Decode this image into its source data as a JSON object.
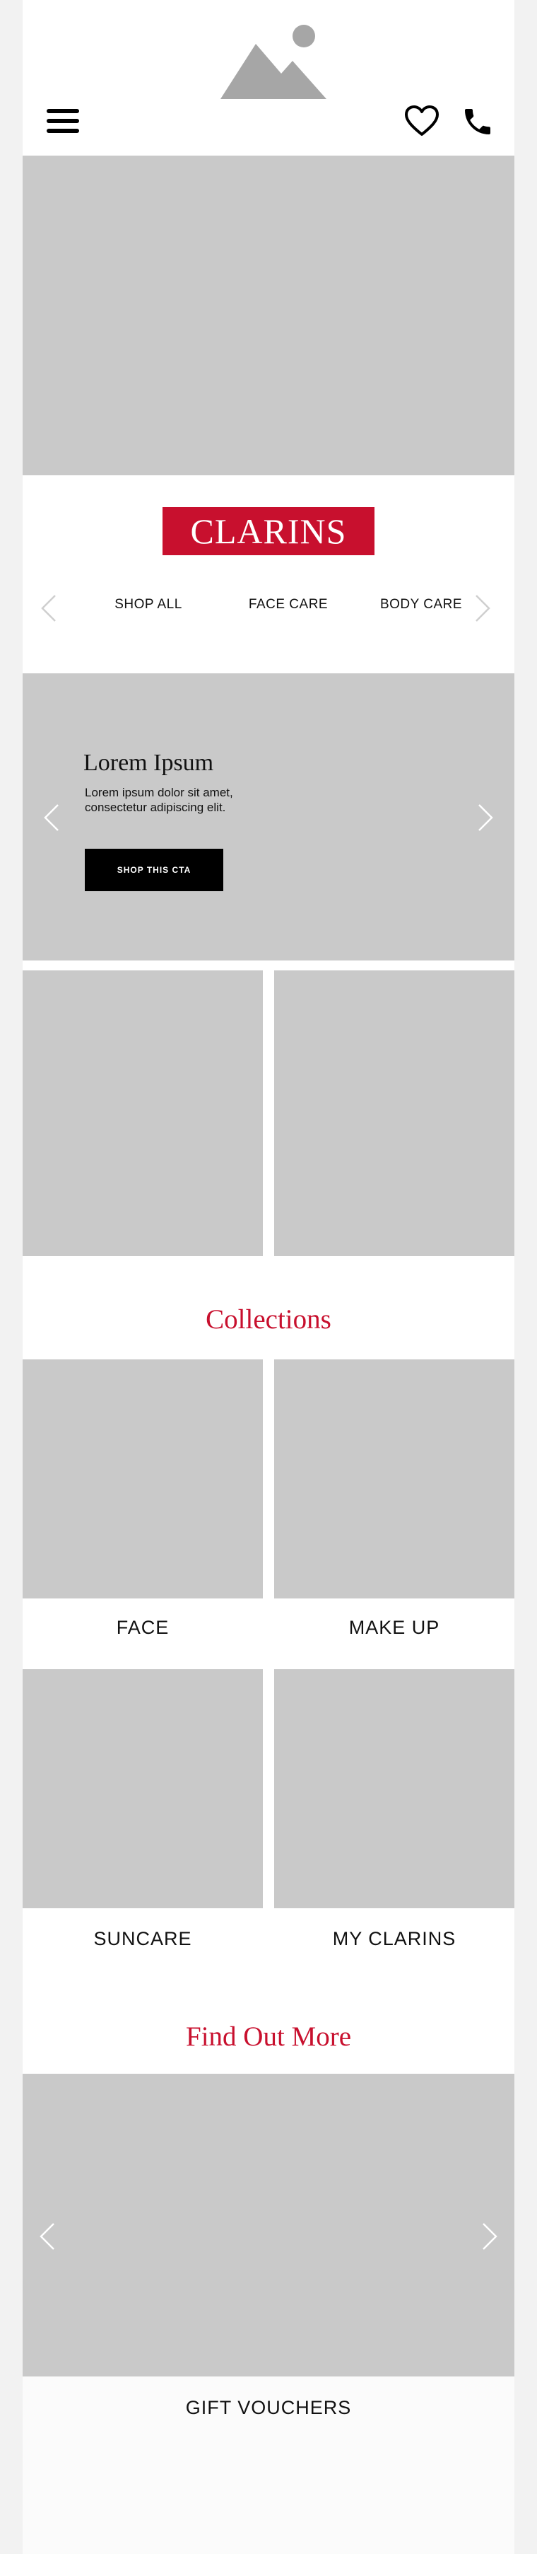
{
  "header": {
    "logo_icon": "image-placeholder-icon",
    "menu_icon": "hamburger-menu-icon",
    "wishlist_icon": "heart-icon",
    "contact_icon": "phone-icon"
  },
  "brand": {
    "wordmark": "CLARINS",
    "color": "#c8102e"
  },
  "nav": {
    "links": [
      "SHOP ALL",
      "FACE CARE",
      "BODY CARE"
    ]
  },
  "promo": {
    "title": "Lorem Ipsum",
    "text": "Lorem ipsum dolor sit amet, consectetur adipiscing elit.",
    "cta": "SHOP THIS CTA"
  },
  "collections": {
    "title": "Collections",
    "items": [
      "FACE",
      "MAKE UP",
      "SUNCARE",
      "MY CLARINS"
    ]
  },
  "find_out_more": {
    "title": "Find Out More",
    "items": [
      "GIFT VOUCHERS"
    ]
  },
  "colors": {
    "accent": "#c8102e",
    "placeholder": "#c9c9c9",
    "background": "#f2f2f2"
  }
}
